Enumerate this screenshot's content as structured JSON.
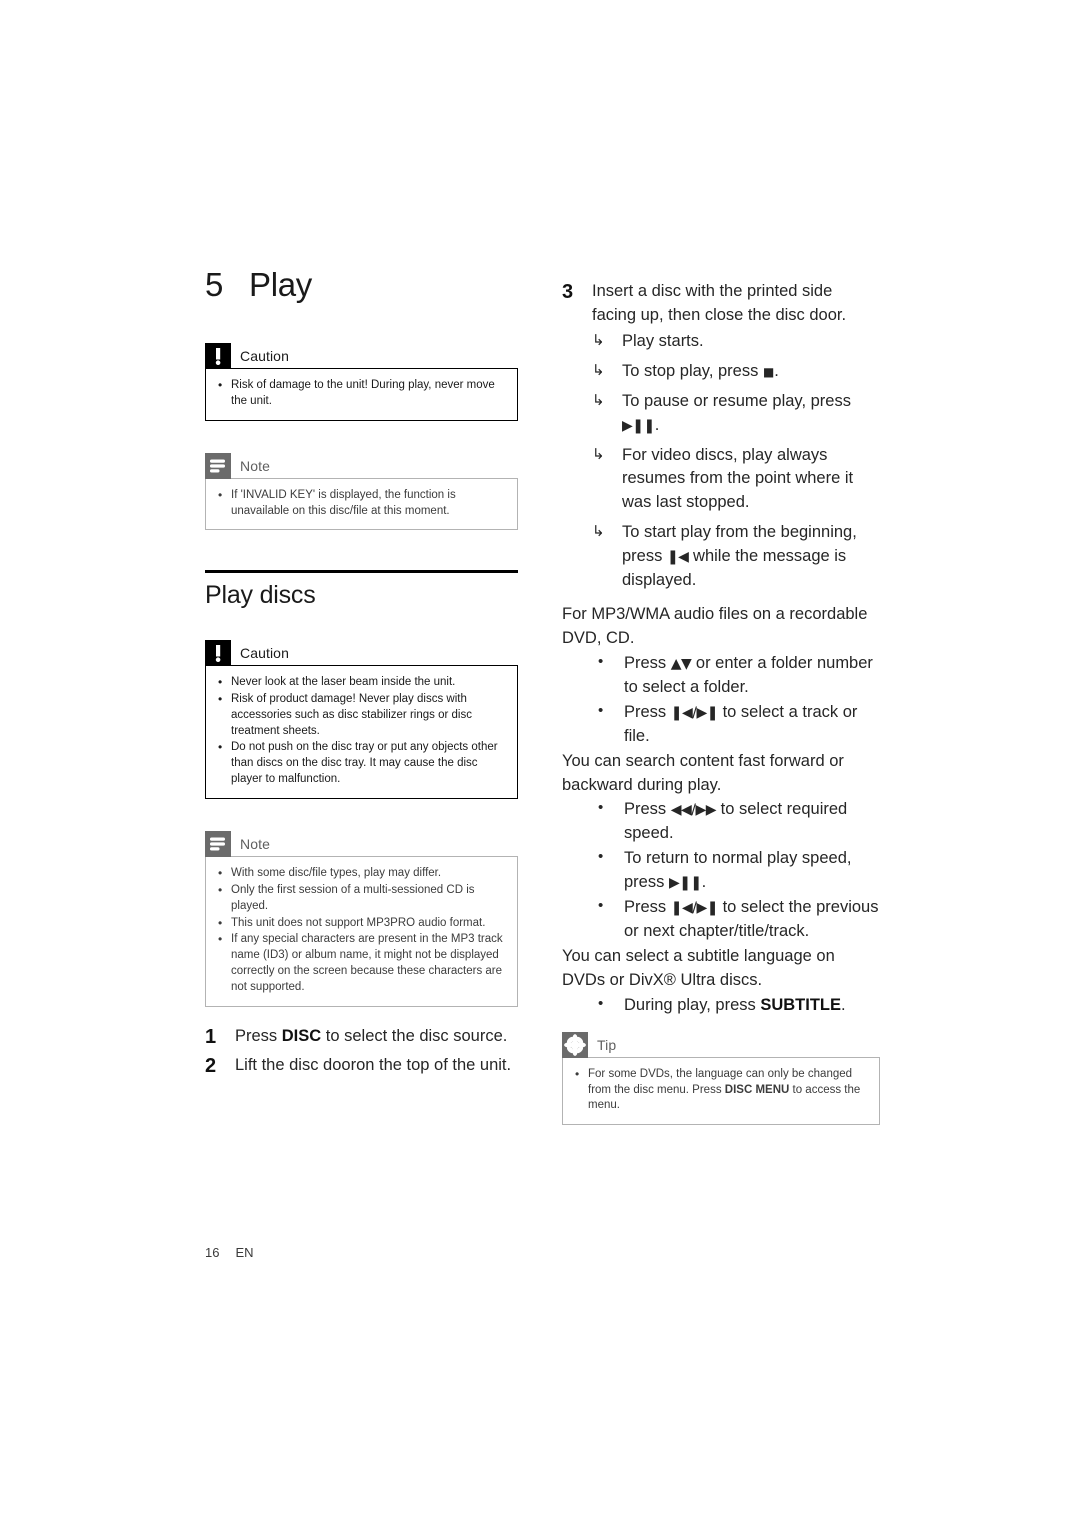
{
  "page": {
    "number": "16",
    "language": "EN"
  },
  "chapter": {
    "number": "5",
    "title": "Play"
  },
  "left_column": {
    "caution_1": {
      "icon": "exclamation-icon",
      "label": "Caution",
      "items": [
        "Risk of damage to the unit! During play, never move the unit."
      ]
    },
    "note_1": {
      "icon": "note-lines-icon",
      "label": "Note",
      "items": [
        "If 'INVALID KEY' is displayed, the function is unavailable on this disc/file at this moment."
      ]
    },
    "section": {
      "heading": "Play discs"
    },
    "caution_2": {
      "icon": "exclamation-icon",
      "label": "Caution",
      "items": [
        "Never look at the laser beam inside the unit.",
        "Risk of product damage! Never play discs with accessories such as disc stabilizer rings or disc treatment sheets.",
        "Do not push on the disc tray or put any objects other than discs on the disc tray. It may cause the disc player to malfunction."
      ]
    },
    "note_2": {
      "icon": "note-lines-icon",
      "label": "Note",
      "items": [
        "With some disc/file types, play may differ.",
        "Only the first session of a multi-sessioned CD is played.",
        "This unit does not support MP3PRO audio format.",
        "If any special characters are present in the MP3 track name (ID3) or album name, it might not be displayed correctly on the screen because these characters are not supported."
      ]
    },
    "steps": [
      {
        "number": "1",
        "text_before": "Press ",
        "bold": "DISC",
        "text_after": " to select the disc source."
      },
      {
        "number": "2",
        "text_before": "Lift the disc dooron the top of the unit.",
        "bold": "",
        "text_after": ""
      }
    ]
  },
  "right_column": {
    "step_3": {
      "number": "3",
      "text": "Insert a disc with the printed side facing up, then close the disc door.",
      "results": [
        {
          "arrow": "right-hook-arrow-icon",
          "text": "Play starts."
        },
        {
          "arrow": "right-hook-arrow-icon",
          "text_before": "To stop play, press ",
          "symbol": "■",
          "text_after": "."
        },
        {
          "arrow": "right-hook-arrow-icon",
          "text_before": "To pause or resume play, press ",
          "symbol": "▶❚❚",
          "text_after": "."
        },
        {
          "arrow": "right-hook-arrow-icon",
          "text": "For video discs, play always resumes from the point where it was last stopped."
        },
        {
          "arrow": "right-hook-arrow-icon",
          "text_before": "To start play from the beginning, press ",
          "symbol": "❚◀",
          "text_after": " while the message is displayed."
        }
      ]
    },
    "mp3_intro": "For MP3/WMA audio files on a recordable DVD, CD.",
    "mp3_bullets": [
      {
        "text_before": "Press ",
        "symbol": "▲▼",
        "text_after": " or enter a folder number to select a folder."
      },
      {
        "text_before": "Press ",
        "symbol": "❚◀/▶❚",
        "text_after": " to select a track or file."
      }
    ],
    "search_intro": "You can search content fast forward or backward during play.",
    "search_bullets": [
      {
        "text_before": "Press ",
        "symbol": "◀◀/▶▶",
        "text_after": " to select required speed."
      },
      {
        "text_before": "To return to normal play speed, press ",
        "symbol": "▶❚❚",
        "text_after": "."
      },
      {
        "text_before": "Press ",
        "symbol": "❚◀/▶❚",
        "text_after": " to select the previous or next chapter/title/track."
      }
    ],
    "subtitle_intro": "You can select a subtitle language on DVDs or DivX® Ultra discs.",
    "subtitle_bullets": [
      {
        "text_before": "During play, press ",
        "bold": "SUBTITLE",
        "text_after": "."
      }
    ],
    "tip": {
      "icon": "asterisk-icon",
      "label": "Tip",
      "items": [
        {
          "text_before": "For some DVDs, the language can only be changed from the disc menu. Press ",
          "bold": "DISC MENU",
          "text_after": " to access the menu."
        }
      ]
    }
  },
  "colors": {
    "caution_icon_bg": "#000000",
    "note_icon_bg": "#6b6b6b",
    "tip_icon_bg": "#6b6b6b",
    "note_border": "#b3b3b3",
    "caution_border": "#000000",
    "body_text": "#262626"
  }
}
